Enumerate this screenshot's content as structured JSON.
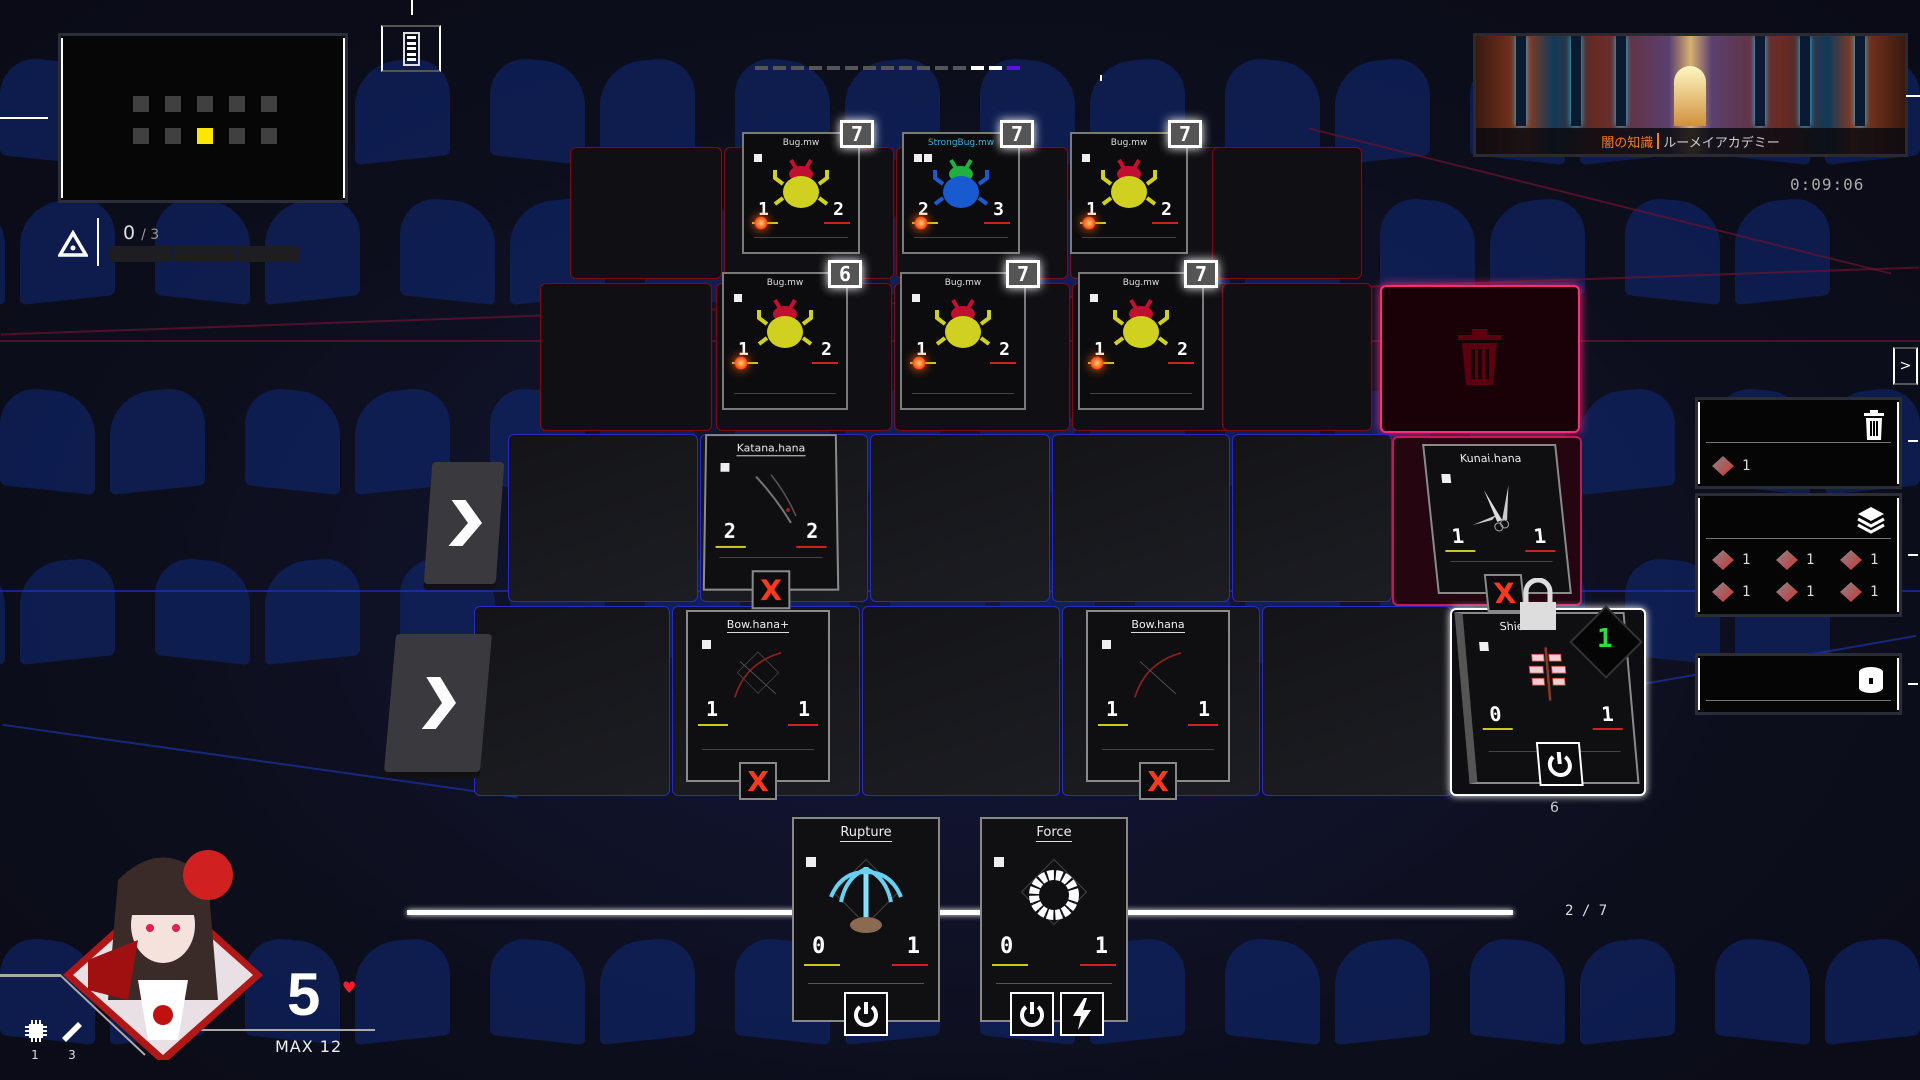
{
  "minimap": {
    "rows": 2,
    "cols": 5,
    "active_index": 7
  },
  "top": {
    "menu_icon": "document-list-icon",
    "progress_dashes": {
      "total": 15,
      "completed": 2,
      "current": 1
    }
  },
  "location": {
    "region": "闇の知識",
    "name": "ルーメイアカデミー",
    "timer": "0:09:06"
  },
  "objective": {
    "icon": "warning-triangle-icon",
    "current": "0",
    "total": "/ 3",
    "progress": 0
  },
  "enemies": [
    {
      "row": 1,
      "col": 1,
      "name": "Bug.mw",
      "attack": "1",
      "health": "2",
      "countdown": "7",
      "pips": 1,
      "variant": "yellow"
    },
    {
      "row": 1,
      "col": 2,
      "name": "StrongBug.mw",
      "attack": "2",
      "health": "3",
      "countdown": "7",
      "pips": 2,
      "variant": "blue"
    },
    {
      "row": 1,
      "col": 3,
      "name": "Bug.mw",
      "attack": "1",
      "health": "2",
      "countdown": "7",
      "pips": 1,
      "variant": "yellow"
    },
    {
      "row": 2,
      "col": 1,
      "name": "Bug.mw",
      "attack": "1",
      "health": "2",
      "countdown": "6",
      "pips": 1,
      "variant": "yellow"
    },
    {
      "row": 2,
      "col": 2,
      "name": "Bug.mw",
      "attack": "1",
      "health": "2",
      "countdown": "7",
      "pips": 1,
      "variant": "yellow"
    },
    {
      "row": 2,
      "col": 3,
      "name": "Bug.mw",
      "attack": "1",
      "health": "2",
      "countdown": "7",
      "pips": 1,
      "variant": "yellow"
    }
  ],
  "player_cards": [
    {
      "name": "Katana.hana",
      "attack": "2",
      "health": "2",
      "action": "disabled-x"
    },
    {
      "name": "Bow.hana+",
      "attack": "1",
      "health": "1",
      "action": "disabled-x"
    },
    {
      "name": "Bow.hana",
      "attack": "1",
      "health": "1",
      "action": "disabled-x"
    },
    {
      "name": "Kunai.hana",
      "attack": "1",
      "health": "1",
      "action": "disabled-x"
    },
    {
      "name": "Shield.hana",
      "name_visible": "Shie",
      "attack": "0",
      "health": "1",
      "action": "power",
      "lock_count": "1",
      "slot_number": "6"
    }
  ],
  "lane_buttons": [
    {
      "label": "advance-row-3"
    },
    {
      "label": "advance-row-4"
    }
  ],
  "side_panel": {
    "toggle_label": ">",
    "discard": {
      "icon": "trash-icon",
      "items": [
        {
          "icon": "kunai-icon",
          "count": "1"
        }
      ]
    },
    "deck": {
      "icon": "layers-icon",
      "items": [
        {
          "icon": "katana-icon",
          "count": "1"
        },
        {
          "icon": "kunai-icon",
          "count": "1"
        },
        {
          "icon": "shield-icon",
          "count": "1"
        },
        {
          "icon": "circuit-icon",
          "count": "1"
        },
        {
          "icon": "triquetra-icon",
          "count": "1"
        },
        {
          "icon": "rupture-icon",
          "count": "1"
        }
      ]
    },
    "storage": {
      "icon": "database-lock-icon",
      "items": []
    }
  },
  "hand": {
    "cards": [
      {
        "name": "Rupture",
        "attack": "0",
        "health": "1",
        "actions": [
          "power"
        ]
      },
      {
        "name": "Force",
        "attack": "0",
        "health": "1",
        "actions": [
          "power",
          "lightning"
        ]
      }
    ],
    "page": "2 / 7"
  },
  "player": {
    "hp": "5",
    "max_label": "MAX 12",
    "chips": "1",
    "pencils": "3"
  },
  "colors": {
    "enemy_border": "#7a0c16",
    "player_border": "#2a2ac8",
    "trash_glow": "#ff2a7a",
    "progress_active": "#5a13e0",
    "minimap_active": "#ffe600"
  }
}
